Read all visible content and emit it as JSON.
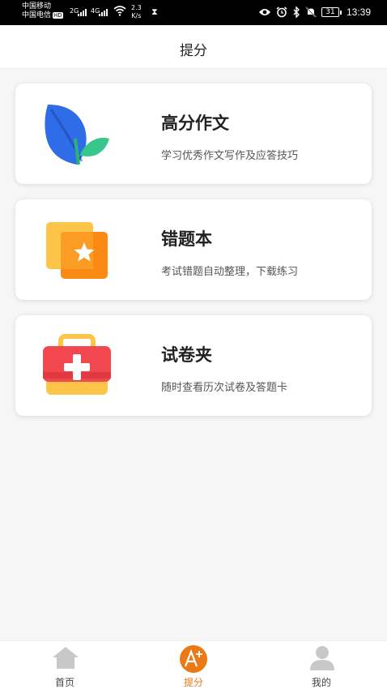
{
  "status_bar": {
    "carrier_1": "中国移动",
    "carrier_2": "中国电信",
    "hd_badge": "HD",
    "signal_1_label": "2G",
    "signal_2_label": "4G",
    "net_speed_value": "2.3",
    "net_speed_unit": "K/s",
    "battery_level": "31",
    "time": "13:39",
    "icons": [
      "eye-icon",
      "alarm-icon",
      "bluetooth-icon",
      "mute-icon",
      "battery-icon"
    ]
  },
  "header": {
    "title": "提分"
  },
  "cards": [
    {
      "title": "高分作文",
      "desc": "学习优秀作文写作及应答技巧",
      "icon": "leaf-icon"
    },
    {
      "title": "错题本",
      "desc": "考试错题自动整理，下载练习",
      "icon": "star-folder-icon"
    },
    {
      "title": "试卷夹",
      "desc": "随时查看历次试卷及答题卡",
      "icon": "medical-kit-icon"
    }
  ],
  "tabbar": {
    "tabs": [
      {
        "label": "首页",
        "icon": "home-icon",
        "active": false
      },
      {
        "label": "提分",
        "icon": "a-plus-icon",
        "active": true
      },
      {
        "label": "我的",
        "icon": "person-icon",
        "active": false
      }
    ]
  },
  "colors": {
    "accent": "#ea7a16",
    "inactive_icon": "#c8c8c8"
  }
}
